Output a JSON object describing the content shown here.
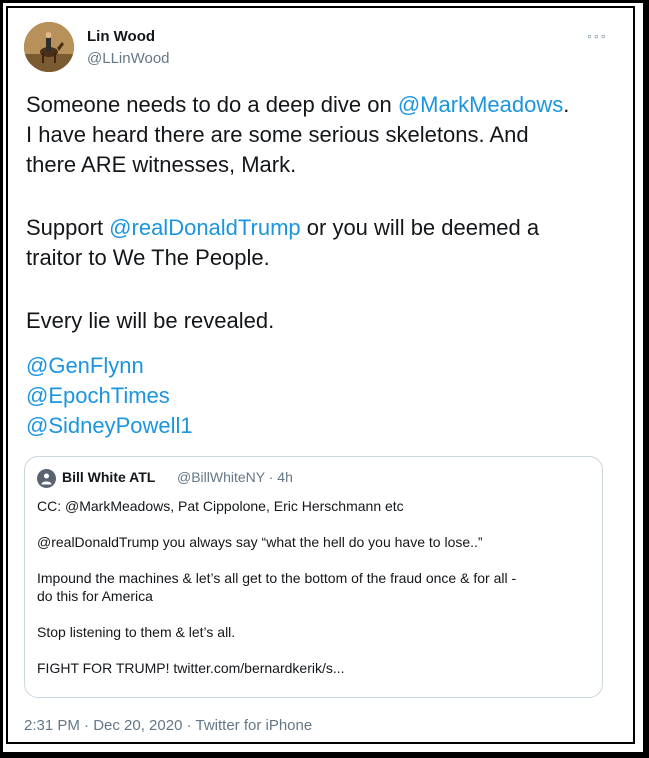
{
  "tweet": {
    "author_name": "Lin Wood",
    "author_handle": "@LLinWood",
    "more_label": "∘∘∘",
    "avatar_icon": "profile-photo",
    "line1_pre": "Someone needs to do a deep dive on ",
    "line1_mention": "@MarkMeadows",
    "line1_post": ".",
    "line2": "I have heard there are some serious skeletons. And",
    "line3": "there ARE witnesses, Mark.",
    "line4_pre": "Support ",
    "line4_mention": "@realDonaldTrump",
    "line4_post": " or you will be deemed a",
    "line5": "traitor to We The People.",
    "line6": "Every lie will be revealed.",
    "mentions": [
      "@GenFlynn",
      "@EpochTimes",
      "@SidneyPowell1"
    ],
    "timestamp": "2:31 PM · Dec 20, 2020 · Twitter for iPhone"
  },
  "quoted_tweet": {
    "avatar_icon": "silhouette-icon",
    "author_name": "Bill White ATL",
    "meta": "@BillWhiteNY · 4h",
    "p1": "CC: @MarkMeadows, Pat Cippolone, Eric Herschmann etc",
    "p2": "@realDonaldTrump you always say “what the hell do you have to lose..”",
    "p3a": "Impound the machines & let’s all get to the bottom of the fraud once & for all -",
    "p3b": "do this for America",
    "p4": "Stop listening to them & let’s all.",
    "p5": "FIGHT FOR TRUMP! twitter.com/bernardkerik/s..."
  },
  "colors": {
    "link": "#1b95e0",
    "text": "#14171a",
    "secondary": "#657786",
    "border": "#ccd6dd"
  }
}
